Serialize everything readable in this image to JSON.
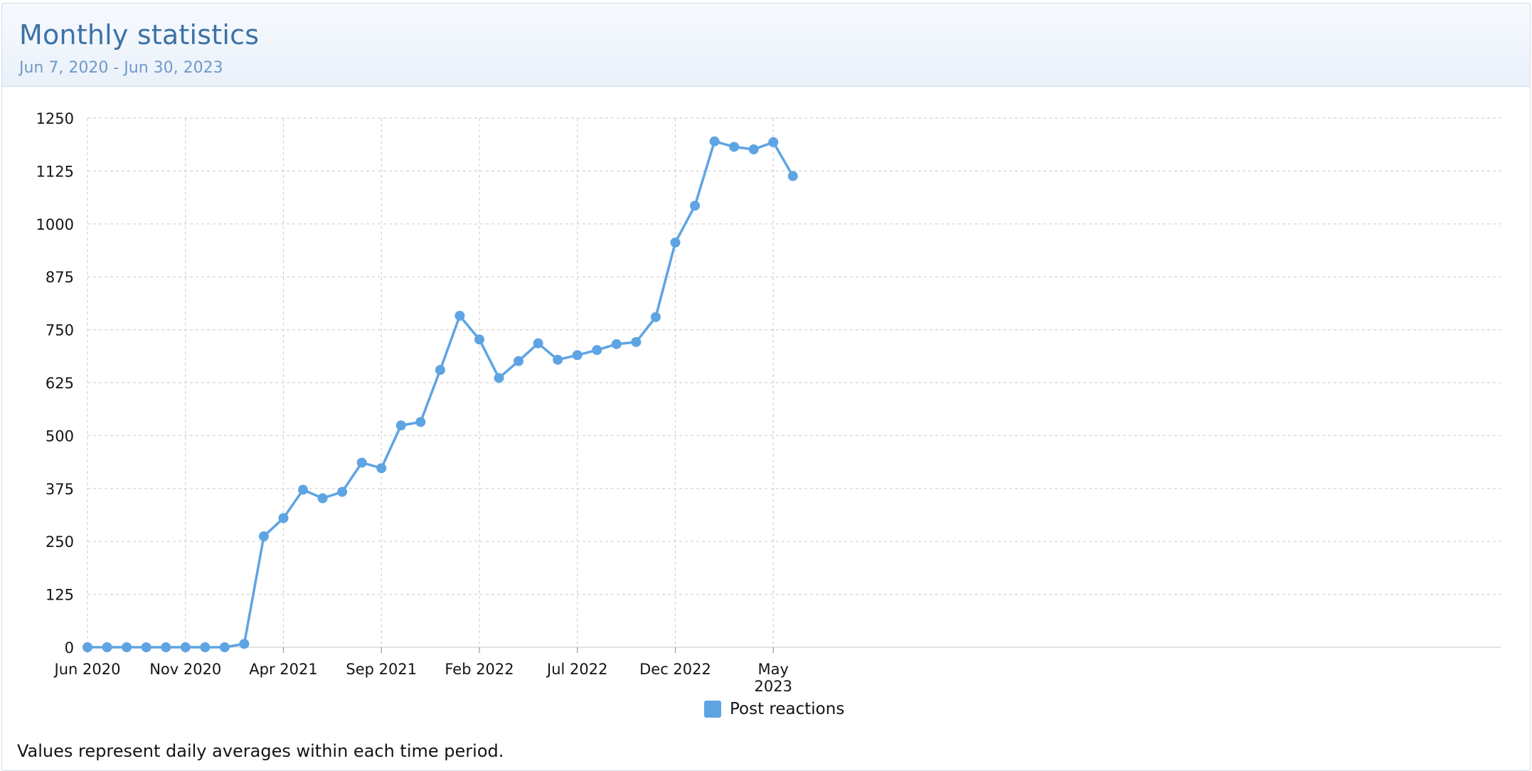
{
  "header": {
    "title": "Monthly statistics",
    "date_range": "Jun 7, 2020 - Jun 30, 2023"
  },
  "footnote": "Values represent daily averages within each time period.",
  "colors": {
    "series": "#5ea4e3",
    "title": "#3d72a6",
    "subtitle": "#6f9ac7",
    "grid": "#d2d2d2"
  },
  "chart_data": {
    "type": "line",
    "title": "",
    "xlabel": "",
    "ylabel": "",
    "ylim": [
      0,
      1250
    ],
    "yticks": [
      0,
      125,
      250,
      375,
      500,
      625,
      750,
      875,
      1000,
      1125,
      1250
    ],
    "xticks": [
      {
        "month": "2020-06",
        "label": "Jun 2020"
      },
      {
        "month": "2020-11",
        "label": "Nov 2020"
      },
      {
        "month": "2021-04",
        "label": "Apr 2021"
      },
      {
        "month": "2021-09",
        "label": "Sep 2021"
      },
      {
        "month": "2022-02",
        "label": "Feb 2022"
      },
      {
        "month": "2022-07",
        "label": "Jul 2022"
      },
      {
        "month": "2022-12",
        "label": "Dec 2022"
      },
      {
        "month": "2023-05",
        "label": "May",
        "label2": "2023"
      }
    ],
    "grid": true,
    "legend_position": "bottom-center",
    "x": [
      "2020-06",
      "2020-07",
      "2020-08",
      "2020-09",
      "2020-10",
      "2020-11",
      "2020-12",
      "2021-01",
      "2021-02",
      "2021-03",
      "2021-04",
      "2021-05",
      "2021-06",
      "2021-07",
      "2021-08",
      "2021-09",
      "2021-10",
      "2021-11",
      "2021-12",
      "2022-01",
      "2022-02",
      "2022-03",
      "2022-04",
      "2022-05",
      "2022-06",
      "2022-07",
      "2022-08",
      "2022-09",
      "2022-10",
      "2022-11",
      "2022-12",
      "2023-01",
      "2023-02",
      "2023-03",
      "2023-04",
      "2023-05",
      "2023-06"
    ],
    "series": [
      {
        "name": "Post reactions",
        "values": [
          0,
          0,
          0,
          0,
          0,
          0,
          0,
          0,
          8,
          262,
          305,
          372,
          352,
          367,
          436,
          423,
          524,
          532,
          655,
          783,
          727,
          636,
          676,
          718,
          679,
          690,
          702,
          716,
          721,
          780,
          956,
          1043,
          1195,
          1182,
          1176,
          1193,
          1113
        ]
      }
    ]
  }
}
